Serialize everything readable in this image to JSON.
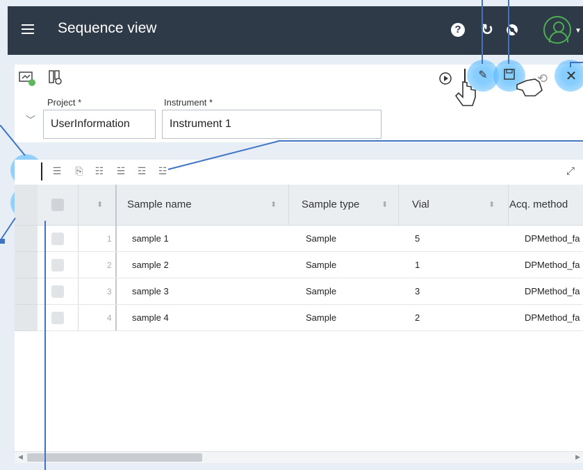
{
  "header": {
    "title": "Sequence view",
    "help_icon": "question-circle-icon",
    "sync_icon": "sync-icon",
    "eye_icon": "eye-off-icon",
    "avatar_color": "#4caf50"
  },
  "form": {
    "project_label": "Project *",
    "project_value": "UserInformation",
    "instrument_label": "Instrument *",
    "instrument_value": "Instrument 1"
  },
  "table": {
    "columns": [
      "Sample name",
      "Sample type",
      "Vial",
      "Acq. method"
    ],
    "rows": [
      {
        "num": "1",
        "name": "sample 1",
        "type": "Sample",
        "vial": "5",
        "method": "DPMethod_fa"
      },
      {
        "num": "2",
        "name": "sample 2",
        "type": "Sample",
        "vial": "1",
        "method": "DPMethod_fa"
      },
      {
        "num": "3",
        "name": "sample 3",
        "type": "Sample",
        "vial": "3",
        "method": "DPMethod_fa"
      },
      {
        "num": "4",
        "name": "sample 4",
        "type": "Sample",
        "vial": "2",
        "method": "DPMethod_fa"
      }
    ]
  },
  "colors": {
    "topbar": "#2f3a48",
    "accent": "#3f74c2",
    "highlight": "#50aaff"
  }
}
